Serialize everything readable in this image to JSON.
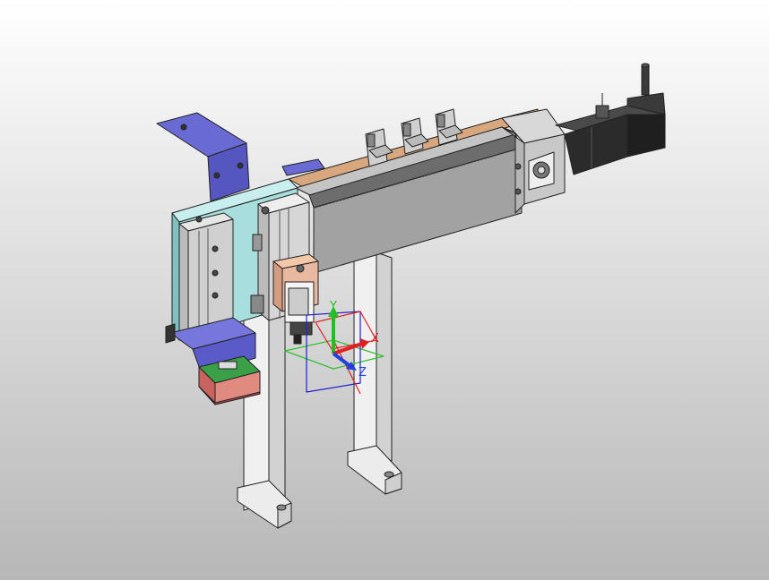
{
  "viewport": {
    "background_top": "#ffffff",
    "background_bottom": "#b7b7b7"
  },
  "model": {
    "colors": {
      "frame": "#ececec",
      "frame_side": "#cfcfcf",
      "module_body": "#9a9a9a",
      "module_top": "#c4c4c4",
      "copper_strip": "#d9a77e",
      "motor": "#2b2b2b",
      "bracket_blue": "#6a6ad4",
      "plate_cyan": "#a9dede",
      "block_pink": "#e8b8a0",
      "block_red": "#c9635f",
      "pcb_green": "#2e8b3a"
    }
  },
  "triad": {
    "x_label": "X",
    "y_label": "Y",
    "z_label": "Z",
    "x_color": "#e02020",
    "y_color": "#20c020",
    "z_color": "#2040e0"
  }
}
